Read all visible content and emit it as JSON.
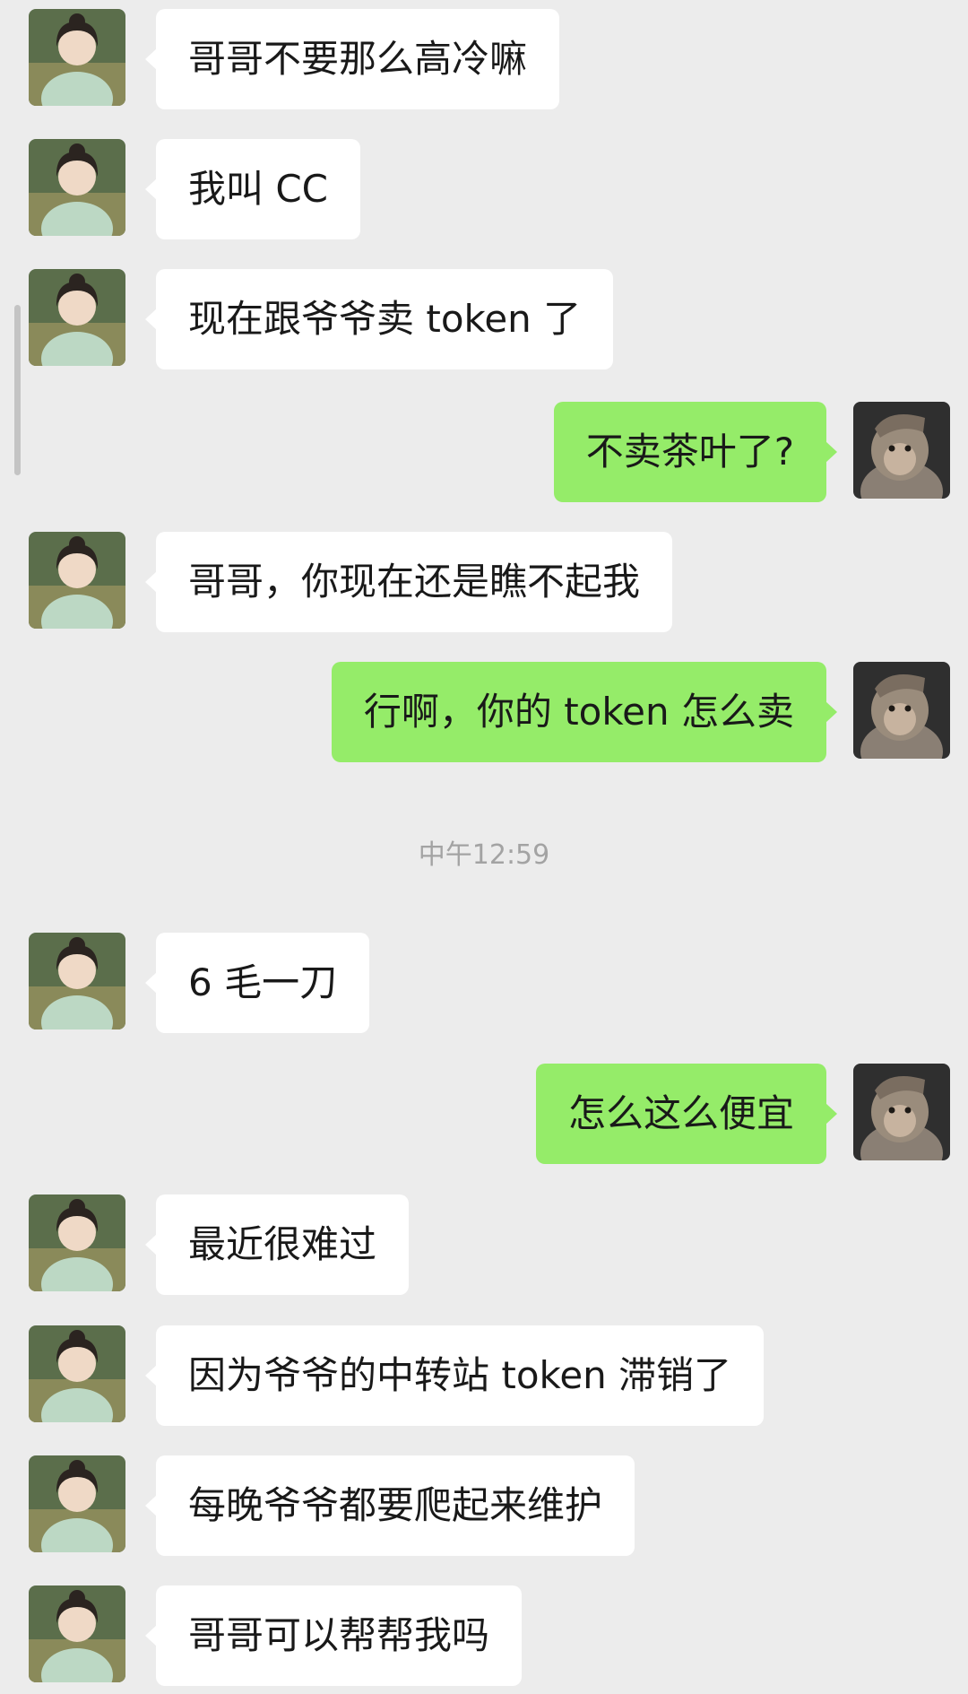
{
  "chat": {
    "messages": [
      {
        "side": "in",
        "text": "哥哥不要那么高冷嘛"
      },
      {
        "side": "in",
        "text": "我叫 CC"
      },
      {
        "side": "in",
        "text": "现在跟爷爷卖 token 了"
      },
      {
        "side": "out",
        "text": "不卖茶叶了?"
      },
      {
        "side": "in",
        "text": "哥哥，你现在还是瞧不起我"
      },
      {
        "side": "out",
        "text": "行啊，你的 token 怎么卖"
      },
      {
        "side": "in",
        "text": "6 毛一刀"
      },
      {
        "side": "out",
        "text": "怎么这么便宜"
      },
      {
        "side": "in",
        "text": "最近很难过"
      },
      {
        "side": "in",
        "text": "因为爷爷的中转站 token 滞销了"
      },
      {
        "side": "in",
        "text": "每晚爷爷都要爬起来维护"
      },
      {
        "side": "in",
        "text": "哥哥可以帮帮我吗"
      }
    ],
    "timestamp": "中午12:59"
  },
  "avatars": {
    "contact": "girl-avatar",
    "self": "monkey-avatar"
  },
  "colors": {
    "background": "#ececec",
    "incoming_bubble": "#ffffff",
    "outgoing_bubble": "#95ec69",
    "text": "#191919",
    "timestamp": "#a3a3a3"
  }
}
